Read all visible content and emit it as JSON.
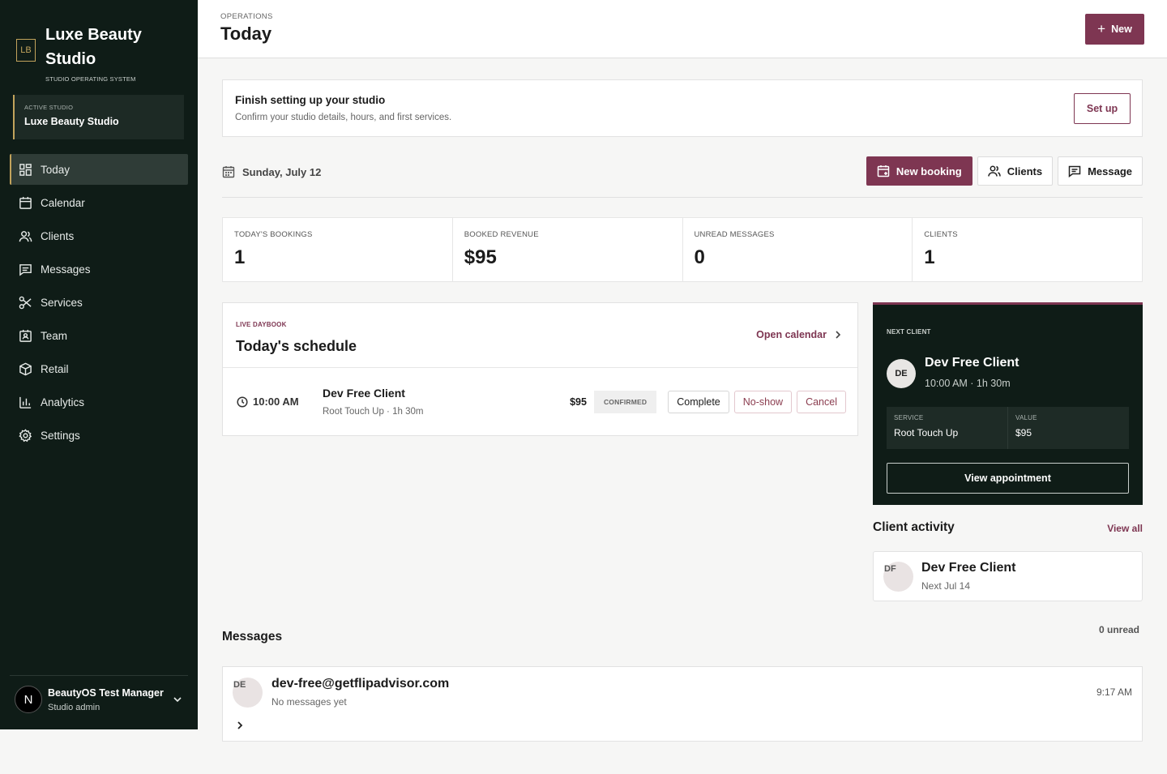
{
  "brand": {
    "logo": "LB",
    "name": "Luxe Beauty Studio",
    "subtitle": "STUDIO OPERATING SYSTEM"
  },
  "active_studio": {
    "label": "ACTIVE STUDIO",
    "value": "Luxe Beauty Studio"
  },
  "nav": [
    {
      "label": "Today",
      "icon": "grid-icon"
    },
    {
      "label": "Calendar",
      "icon": "calendar-icon"
    },
    {
      "label": "Clients",
      "icon": "users-icon"
    },
    {
      "label": "Messages",
      "icon": "message-icon"
    },
    {
      "label": "Services",
      "icon": "scissors-icon"
    },
    {
      "label": "Team",
      "icon": "badge-icon"
    },
    {
      "label": "Retail",
      "icon": "box-icon"
    },
    {
      "label": "Analytics",
      "icon": "bar-chart-icon"
    },
    {
      "label": "Settings",
      "icon": "gear-icon"
    }
  ],
  "user": {
    "initial": "N",
    "name": "BeautyOS Test Manager",
    "role": "Studio admin"
  },
  "header": {
    "crumb": "OPERATIONS",
    "title": "Today",
    "new_label": "New"
  },
  "setup": {
    "title": "Finish setting up your studio",
    "desc": "Confirm your studio details, hours, and first services.",
    "button": "Set up"
  },
  "date_bar": {
    "date": "Sunday, July 12",
    "new_booking": "New booking",
    "clients": "Clients",
    "message": "Message"
  },
  "stats": [
    {
      "label": "TODAY'S BOOKINGS",
      "value": "1"
    },
    {
      "label": "BOOKED REVENUE",
      "value": "$95"
    },
    {
      "label": "UNREAD MESSAGES",
      "value": "0"
    },
    {
      "label": "CLIENTS",
      "value": "1"
    }
  ],
  "schedule": {
    "kicker": "LIVE DAYBOOK",
    "title": "Today's schedule",
    "open_calendar": "Open calendar",
    "appointment": {
      "time": "10:00 AM",
      "client": "Dev Free Client",
      "desc": "Root Touch Up · 1h 30m",
      "price": "$95",
      "status": "CONFIRMED",
      "complete": "Complete",
      "no_show": "No-show",
      "cancel": "Cancel"
    }
  },
  "next_client": {
    "kicker": "NEXT CLIENT",
    "initials": "DE",
    "name": "Dev Free Client",
    "time": "10:00 AM · 1h 30m",
    "service_label": "SERVICE",
    "service": "Root Touch Up",
    "value_label": "VALUE",
    "value": "$95",
    "view": "View appointment"
  },
  "activity": {
    "title": "Client activity",
    "view_all": "View all",
    "item": {
      "initials": "DF",
      "name": "Dev Free Client",
      "sub": "Next Jul 14"
    }
  },
  "messages": {
    "title": "Messages",
    "unread": "0 unread",
    "item": {
      "initials": "DE",
      "email": "dev-free@getflipadvisor.com",
      "preview": "No messages yet",
      "time": "9:17 AM"
    }
  },
  "colors": {
    "sidebar": "#0f1c17",
    "accent": "#7e3652",
    "gold": "#c2a35c"
  }
}
